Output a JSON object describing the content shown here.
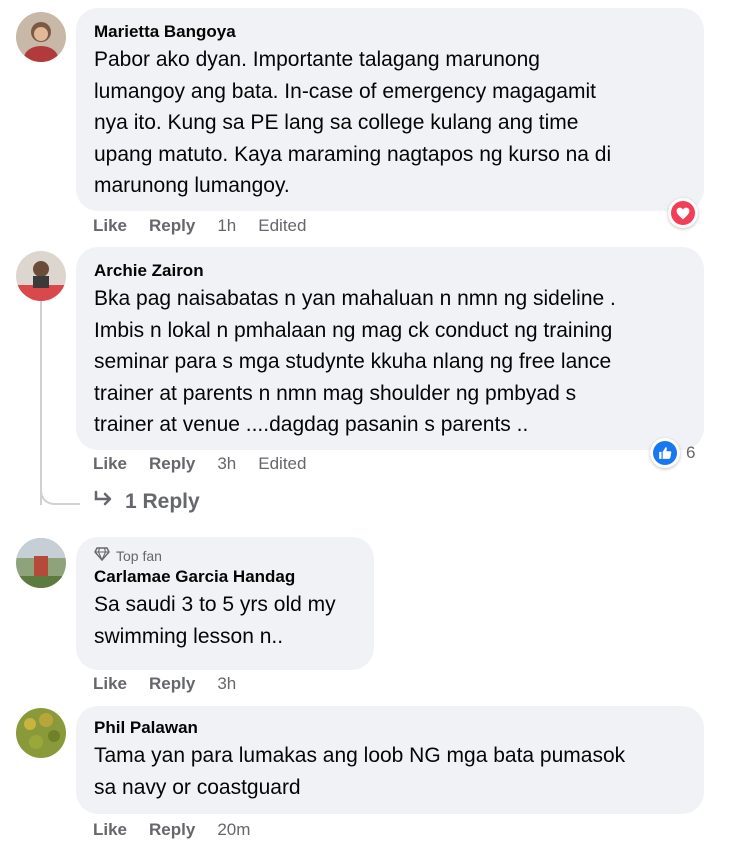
{
  "comments": [
    {
      "author": "Marietta Bangoya",
      "lines": [
        "Pabor ako dyan. Importante talagang marunong",
        "lumangoy ang bata. In-case of emergency magagamit",
        "nya ito. Kung sa PE lang sa college kulang ang time",
        "upang matuto. Kaya maraming nagtapos ng kurso na di",
        "marunong lumangoy."
      ],
      "like_label": "Like",
      "reply_label": "Reply",
      "time": "1h",
      "edited": "Edited",
      "reaction_icon": "heart-icon",
      "reaction_color": "#f33e58"
    },
    {
      "author": "Archie Zairon",
      "lines": [
        "Bka pag naisabatas n yan mahaluan n nmn ng sideline .",
        "Imbis n lokal n pmhalaan ng mag ck conduct ng training",
        "seminar para s mga studynte kkuha nlang ng free lance",
        "trainer at parents n nmn mag shoulder ng pmbyad s",
        "trainer at venue ....dagdag pasanin s parents .."
      ],
      "like_label": "Like",
      "reply_label": "Reply",
      "time": "3h",
      "edited": "Edited",
      "reaction_icon": "thumbs-up-icon",
      "reaction_color": "#1877f2",
      "reaction_count": "6",
      "replies_label": "1 Reply"
    },
    {
      "badge": "Top fan",
      "author": "Carlamae Garcia Handag",
      "lines": [
        "Sa saudi 3 to 5 yrs old my",
        "swimming lesson n.."
      ],
      "like_label": "Like",
      "reply_label": "Reply",
      "time": "3h"
    },
    {
      "author": "Phil Palawan",
      "lines": [
        "Tama yan para lumakas ang loob NG mga bata pumasok",
        "sa navy or coastguard"
      ],
      "like_label": "Like",
      "reply_label": "Reply",
      "time": "20m"
    }
  ]
}
